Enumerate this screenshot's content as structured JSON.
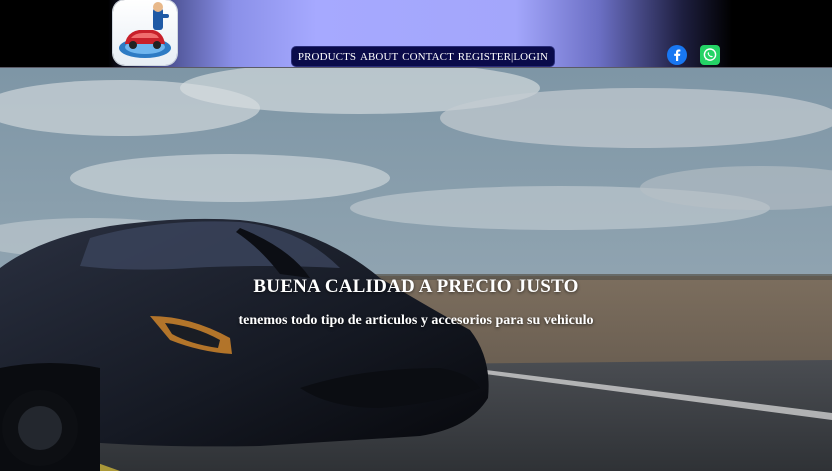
{
  "header": {
    "logo_icon": "mechanic-car-logo-icon",
    "nav": [
      {
        "label": "PRODUCTS"
      },
      {
        "label": "ABOUT"
      },
      {
        "label": "CONTACT"
      },
      {
        "label": "REGISTER|LOGIN"
      }
    ],
    "social": [
      {
        "icon": "facebook-icon",
        "color": "#1877f2"
      },
      {
        "icon": "whatsapp-icon",
        "color": "#25d366"
      }
    ]
  },
  "hero": {
    "title": "BUENA CALIDAD A PRECIO JUSTO",
    "subtitle": "tenemos todo tipo de articulos y accesorios para su vehiculo",
    "background": "sports-car-on-road-image"
  },
  "colors": {
    "nav_bg": "#0a0b4a",
    "header_accent": "#a6a9ff"
  }
}
